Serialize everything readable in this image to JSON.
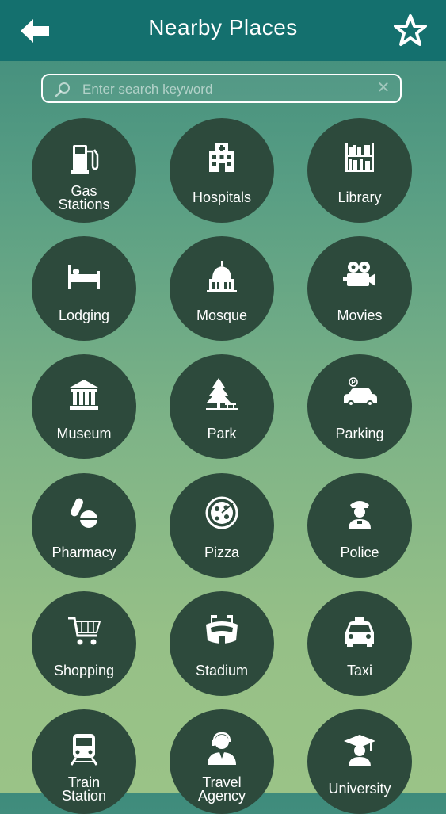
{
  "header": {
    "title": "Nearby Places"
  },
  "search": {
    "placeholder": "Enter search keyword"
  },
  "places": [
    {
      "label": "Gas\nStations",
      "icon": "gas-station-icon"
    },
    {
      "label": "Hospitals",
      "icon": "hospital-icon"
    },
    {
      "label": "Library",
      "icon": "library-icon"
    },
    {
      "label": "Lodging",
      "icon": "bed-icon"
    },
    {
      "label": "Mosque",
      "icon": "mosque-icon"
    },
    {
      "label": "Movies",
      "icon": "movie-camera-icon"
    },
    {
      "label": "Museum",
      "icon": "museum-icon"
    },
    {
      "label": "Park",
      "icon": "tree-icon"
    },
    {
      "label": "Parking",
      "icon": "parking-car-icon"
    },
    {
      "label": "Pharmacy",
      "icon": "pills-icon"
    },
    {
      "label": "Pizza",
      "icon": "pizza-icon"
    },
    {
      "label": "Police",
      "icon": "police-officer-icon"
    },
    {
      "label": "Shopping",
      "icon": "shopping-cart-icon"
    },
    {
      "label": "Stadium",
      "icon": "stadium-icon"
    },
    {
      "label": "Taxi",
      "icon": "taxi-icon"
    },
    {
      "label": "Train\nStation",
      "icon": "train-icon"
    },
    {
      "label": "Travel\nAgency",
      "icon": "travel-agent-icon"
    },
    {
      "label": "University",
      "icon": "graduation-cap-icon"
    }
  ]
}
